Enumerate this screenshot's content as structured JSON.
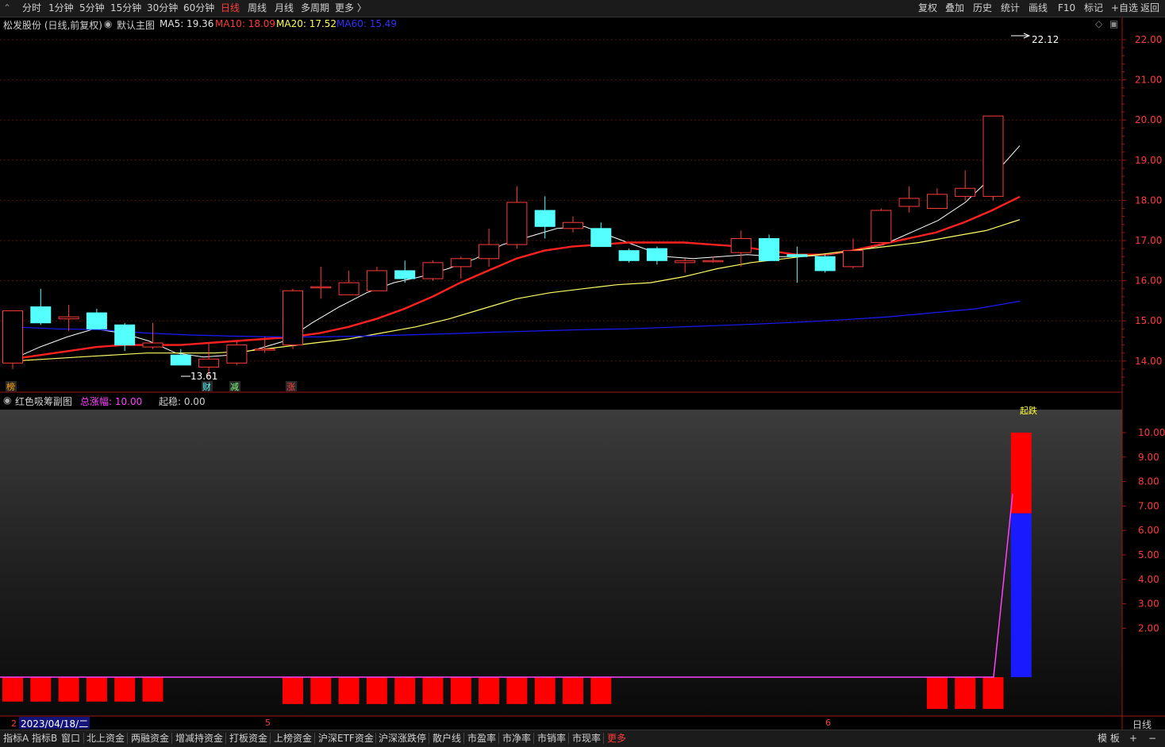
{
  "toolbar": {
    "periods": [
      "分时",
      "1分钟",
      "5分钟",
      "15分钟",
      "30分钟",
      "60分钟",
      "日线",
      "周线",
      "月线",
      "多周期",
      "更多 〉"
    ],
    "active_period": "日线",
    "right": [
      "复权",
      "叠加",
      "历史",
      "统计",
      "画线",
      "F10",
      "标记",
      "+自选",
      "返回"
    ]
  },
  "main_info": {
    "stock": "松发股份 (日线,前复权)",
    "template": "默认主图",
    "ma5": "MA5: 19.36",
    "ma10": "MA10: 18.09",
    "ma20": "MA20: 17.52",
    "ma60": "MA60: 15.49"
  },
  "sub_info": {
    "name": "红色吸筹副图",
    "total_label": "总涨幅: 10.00",
    "start_label": "起稳: 0.00"
  },
  "colors": {
    "up": "#ff3b3b",
    "down": "#54ffff",
    "ma5": "#ffffff",
    "ma10": "#ff2020",
    "ma20": "#ffff66",
    "ma60": "#1a1aff",
    "sub_red": "#ff0000",
    "sub_blue": "#1a1aff",
    "sub_line": "#ff40ff"
  },
  "markers": {
    "high_label": "22.12",
    "low_label": "13.61",
    "events": [
      "榜",
      "财",
      "减",
      "涨"
    ],
    "bar_tag": "起跌"
  },
  "x_axis": {
    "cursor_date": "2023/04/18/二",
    "month_ticks": [
      "5",
      "6"
    ],
    "period_label": "日线"
  },
  "bottom_tabs": [
    "指标A",
    "指标B",
    "窗口",
    "北上资金",
    "两融资金",
    "增减持资金",
    "打板资金",
    "上榜资金",
    "沪深ETF资金",
    "沪深涨跌停",
    "散户线",
    "市盈率",
    "市净率",
    "市销率",
    "市现率",
    "更多"
  ],
  "bottom_right": [
    "模 板",
    "+",
    "−"
  ],
  "chart_data": [
    {
      "type": "candlestick",
      "title": "松发股份 (日线,前复权)",
      "ylim": [
        13.3,
        22.5
      ],
      "yticks": [
        "22.00",
        "21.00",
        "20.00",
        "19.00",
        "18.00",
        "17.00",
        "16.00",
        "15.00",
        "14.00"
      ],
      "candles": [
        {
          "o": 13.95,
          "h": 15.25,
          "l": 13.8,
          "c": 15.25
        },
        {
          "o": 15.35,
          "h": 15.8,
          "l": 14.9,
          "c": 14.95
        },
        {
          "o": 15.05,
          "h": 15.4,
          "l": 14.75,
          "c": 15.1
        },
        {
          "o": 15.2,
          "h": 15.3,
          "l": 14.8,
          "c": 14.8
        },
        {
          "o": 14.9,
          "h": 14.95,
          "l": 14.25,
          "c": 14.4
        },
        {
          "o": 14.35,
          "h": 14.95,
          "l": 14.3,
          "c": 14.45
        },
        {
          "o": 14.15,
          "h": 14.3,
          "l": 13.9,
          "c": 13.9
        },
        {
          "o": 13.85,
          "h": 14.45,
          "l": 13.61,
          "c": 14.05
        },
        {
          "o": 13.95,
          "h": 14.5,
          "l": 13.9,
          "c": 14.4
        },
        {
          "o": 14.3,
          "h": 14.6,
          "l": 14.2,
          "c": 14.3
        },
        {
          "o": 14.4,
          "h": 15.8,
          "l": 14.3,
          "c": 15.75
        },
        {
          "o": 15.85,
          "h": 16.35,
          "l": 15.55,
          "c": 15.85
        },
        {
          "o": 15.65,
          "h": 16.25,
          "l": 15.65,
          "c": 15.95
        },
        {
          "o": 15.75,
          "h": 16.35,
          "l": 15.75,
          "c": 16.25
        },
        {
          "o": 16.25,
          "h": 16.5,
          "l": 15.95,
          "c": 16.05
        },
        {
          "o": 16.05,
          "h": 16.5,
          "l": 16.0,
          "c": 16.45
        },
        {
          "o": 16.35,
          "h": 16.6,
          "l": 16.05,
          "c": 16.55
        },
        {
          "o": 16.55,
          "h": 17.3,
          "l": 16.35,
          "c": 16.9
        },
        {
          "o": 16.9,
          "h": 18.35,
          "l": 16.8,
          "c": 17.95
        },
        {
          "o": 17.75,
          "h": 18.1,
          "l": 17.05,
          "c": 17.35
        },
        {
          "o": 17.3,
          "h": 17.6,
          "l": 17.2,
          "c": 17.45
        },
        {
          "o": 17.3,
          "h": 17.45,
          "l": 16.85,
          "c": 16.85
        },
        {
          "o": 16.75,
          "h": 16.8,
          "l": 16.45,
          "c": 16.5
        },
        {
          "o": 16.8,
          "h": 16.85,
          "l": 16.4,
          "c": 16.5
        },
        {
          "o": 16.45,
          "h": 16.55,
          "l": 16.2,
          "c": 16.5
        },
        {
          "o": 16.5,
          "h": 16.6,
          "l": 16.45,
          "c": 16.5
        },
        {
          "o": 16.7,
          "h": 17.25,
          "l": 16.35,
          "c": 17.05
        },
        {
          "o": 17.05,
          "h": 17.15,
          "l": 16.5,
          "c": 16.5
        },
        {
          "o": 16.65,
          "h": 16.85,
          "l": 15.95,
          "c": 16.6
        },
        {
          "o": 16.6,
          "h": 16.65,
          "l": 16.2,
          "c": 16.25
        },
        {
          "o": 16.35,
          "h": 17.05,
          "l": 16.3,
          "c": 16.75
        },
        {
          "o": 16.95,
          "h": 17.8,
          "l": 16.95,
          "c": 17.75
        },
        {
          "o": 17.85,
          "h": 18.35,
          "l": 17.7,
          "c": 18.05
        },
        {
          "o": 17.8,
          "h": 18.3,
          "l": 17.8,
          "c": 18.15
        },
        {
          "o": 18.1,
          "h": 18.75,
          "l": 18.0,
          "c": 18.3
        },
        {
          "o": 18.1,
          "h": 20.1,
          "l": 18.0,
          "c": 20.1
        }
      ],
      "series": [
        {
          "name": "MA5",
          "values": [
            14.05,
            14.35,
            14.6,
            14.8,
            14.7,
            14.5,
            14.2,
            14.1,
            14.15,
            14.3,
            14.5,
            14.95,
            15.35,
            15.7,
            15.95,
            16.1,
            16.3,
            16.55,
            16.9,
            17.1,
            17.3,
            17.35,
            17.1,
            16.85,
            16.6,
            16.55,
            16.6,
            16.65,
            16.6,
            16.6,
            16.65,
            16.75,
            16.9,
            17.2,
            17.5,
            17.95,
            18.6,
            19.36
          ]
        },
        {
          "name": "MA10",
          "values": [
            14.05,
            14.15,
            14.25,
            14.35,
            14.4,
            14.4,
            14.4,
            14.45,
            14.5,
            14.55,
            14.6,
            14.7,
            14.85,
            15.05,
            15.3,
            15.6,
            15.95,
            16.25,
            16.55,
            16.75,
            16.85,
            16.9,
            16.95,
            16.95,
            16.95,
            16.9,
            16.85,
            16.75,
            16.65,
            16.65,
            16.75,
            16.9,
            17.05,
            17.2,
            17.45,
            17.75,
            18.09
          ]
        },
        {
          "name": "MA20",
          "values": [
            14.0,
            14.05,
            14.1,
            14.15,
            14.2,
            14.2,
            14.2,
            14.25,
            14.35,
            14.45,
            14.55,
            14.7,
            14.85,
            15.05,
            15.3,
            15.55,
            15.7,
            15.8,
            15.9,
            15.95,
            16.1,
            16.3,
            16.45,
            16.55,
            16.65,
            16.75,
            16.85,
            16.95,
            17.1,
            17.25,
            17.52
          ]
        },
        {
          "name": "MA60",
          "values": [
            14.85,
            14.8,
            14.78,
            14.7,
            14.65,
            14.62,
            14.6,
            14.6,
            14.62,
            14.65,
            14.68,
            14.72,
            14.75,
            14.78,
            14.8,
            14.84,
            14.88,
            14.92,
            14.97,
            15.03,
            15.1,
            15.2,
            15.3,
            15.49
          ]
        }
      ]
    },
    {
      "type": "bar",
      "title": "红色吸筹副图",
      "ylim": [
        -1.5,
        11.5
      ],
      "yticks": [
        "10.00",
        "9.00",
        "8.00",
        "7.00",
        "6.00",
        "5.00",
        "4.00",
        "3.00",
        "2.00"
      ],
      "red_bars": [
        {
          "day": 0,
          "value": -1.0
        },
        {
          "day": 1,
          "value": -1.0
        },
        {
          "day": 2,
          "value": -1.0
        },
        {
          "day": 3,
          "value": -1.0
        },
        {
          "day": 4,
          "value": -1.0
        },
        {
          "day": 5,
          "value": -1.0
        },
        {
          "day": 10,
          "value": -1.1
        },
        {
          "day": 11,
          "value": -1.1
        },
        {
          "day": 12,
          "value": -1.1
        },
        {
          "day": 13,
          "value": -1.1
        },
        {
          "day": 14,
          "value": -1.1
        },
        {
          "day": 15,
          "value": -1.1
        },
        {
          "day": 16,
          "value": -1.1
        },
        {
          "day": 17,
          "value": -1.1
        },
        {
          "day": 18,
          "value": -1.1
        },
        {
          "day": 19,
          "value": -1.1
        },
        {
          "day": 20,
          "value": -1.1
        },
        {
          "day": 21,
          "value": -1.1
        },
        {
          "day": 33,
          "value": -1.3
        },
        {
          "day": 34,
          "value": -1.3
        },
        {
          "day": 35,
          "value": -1.3
        },
        {
          "day": 36,
          "from": 6.7,
          "to": 10.0
        }
      ],
      "blue_bars": [
        {
          "day": 36,
          "from": 0.0,
          "to": 6.7
        }
      ],
      "line": [
        0,
        0,
        0,
        0,
        0,
        0,
        0,
        0,
        0,
        0,
        0,
        0,
        0,
        0,
        0,
        0,
        0,
        0,
        0,
        0,
        0,
        0,
        0,
        0,
        0,
        0,
        0,
        0,
        0,
        0,
        0,
        0,
        0,
        0,
        0,
        0,
        7.5
      ]
    }
  ]
}
